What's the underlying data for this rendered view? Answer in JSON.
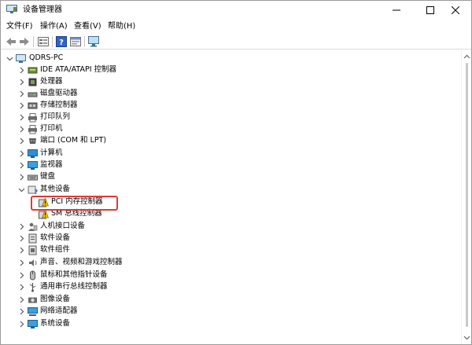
{
  "window": {
    "title": "设备管理器"
  },
  "menu": [
    "文件(F)",
    "操作(A)",
    "查看(V)",
    "帮助(H)"
  ],
  "toolbar": [
    {
      "name": "back-icon"
    },
    {
      "name": "forward-icon"
    },
    {
      "name": "device-view-icon"
    },
    {
      "name": "help-icon"
    },
    {
      "name": "properties-icon"
    },
    {
      "name": "monitor-scan-icon"
    }
  ],
  "tree": {
    "root": "QDRS-PC",
    "categories": [
      {
        "label": "IDE ATA/ATAPI 控制器",
        "icon": "ide-controller-icon"
      },
      {
        "label": "处理器",
        "icon": "processor-icon"
      },
      {
        "label": "磁盘驱动器",
        "icon": "disk-drive-icon"
      },
      {
        "label": "存储控制器",
        "icon": "storage-controller-icon"
      },
      {
        "label": "打印队列",
        "icon": "print-queue-icon"
      },
      {
        "label": "打印机",
        "icon": "printer-icon"
      },
      {
        "label": "端口 (COM 和 LPT)",
        "icon": "port-icon"
      },
      {
        "label": "计算机",
        "icon": "computer-icon"
      },
      {
        "label": "监视器",
        "icon": "monitor-icon"
      },
      {
        "label": "键盘",
        "icon": "keyboard-icon"
      },
      {
        "label": "其他设备",
        "icon": "other-devices-icon",
        "expanded": true
      },
      {
        "label": "人机接口设备",
        "icon": "hid-icon"
      },
      {
        "label": "软件设备",
        "icon": "software-device-icon"
      },
      {
        "label": "软件组件",
        "icon": "software-component-icon"
      },
      {
        "label": "声音、视频和游戏控制器",
        "icon": "sound-icon"
      },
      {
        "label": "鼠标和其他指针设备",
        "icon": "mouse-icon"
      },
      {
        "label": "通用串行总线控制器",
        "icon": "usb-icon"
      },
      {
        "label": "图像设备",
        "icon": "camera-icon"
      },
      {
        "label": "网络适配器",
        "icon": "network-adapter-icon"
      },
      {
        "label": "系统设备",
        "icon": "system-device-icon"
      }
    ],
    "other_devices_children": [
      {
        "label": "PCI 内存控制器",
        "icon": "warning-device-icon",
        "highlighted": true
      },
      {
        "label": "SM 总线控制器",
        "icon": "warning-device-icon"
      }
    ]
  },
  "colors": {
    "highlight": "#e03a3a",
    "warning": "#f2c200"
  }
}
